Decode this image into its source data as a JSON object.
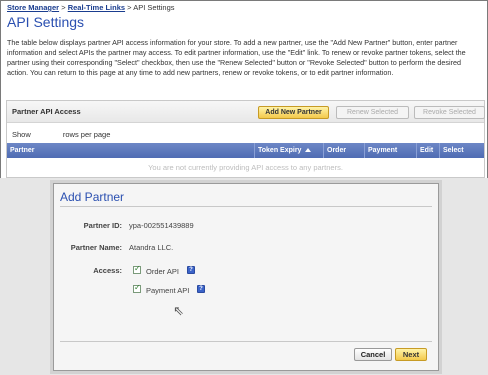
{
  "breadcrumb": {
    "store_manager": "Store Manager",
    "sep1": ">",
    "real_time_links": "Real-Time Links",
    "sep2": ">",
    "current": "API Settings"
  },
  "page_title": "API Settings",
  "description": "The table below displays partner API access information for your store. To add a new partner, use the \"Add New Partner\" button, enter partner information and select APIs the partner may access. To edit partner information, use the \"Edit\" link. To renew or revoke partner tokens, select the partner using their corresponding \"Select\" checkbox, then use the \"Renew Selected\" button or \"Revoke Selected\" button to perform the desired action. You can return to this page at any time to add new partners, renew or revoke tokens, or to edit partner information.",
  "panel": {
    "title": "Partner API Access",
    "add_button": "Add New Partner",
    "renew_button": "Renew Selected",
    "revoke_button": "Revoke Selected",
    "show_label": "Show",
    "rows_per_page_label": "rows per page",
    "columns": [
      "Partner",
      "Token Expiry",
      "Order",
      "Payment",
      "Edit",
      "Select"
    ],
    "empty_message": "You are not currently providing API access to any partners."
  },
  "modal": {
    "title": "Add Partner",
    "partner_id_label": "Partner ID:",
    "partner_id_value": "ypa-002551439889",
    "partner_name_label": "Partner Name:",
    "partner_name_value": "Atandra LLC.",
    "access_label": "Access:",
    "access_options": [
      {
        "label": "Order API",
        "checked": true
      },
      {
        "label": "Payment API",
        "checked": true
      }
    ],
    "help_glyph": "?",
    "cancel_button": "Cancel",
    "next_button": "Next"
  },
  "colors": {
    "title_blue": "#2a4fb0",
    "link_blue": "#1a3d8f",
    "table_header": "#5872b8",
    "primary_button": "#f3c94b"
  }
}
